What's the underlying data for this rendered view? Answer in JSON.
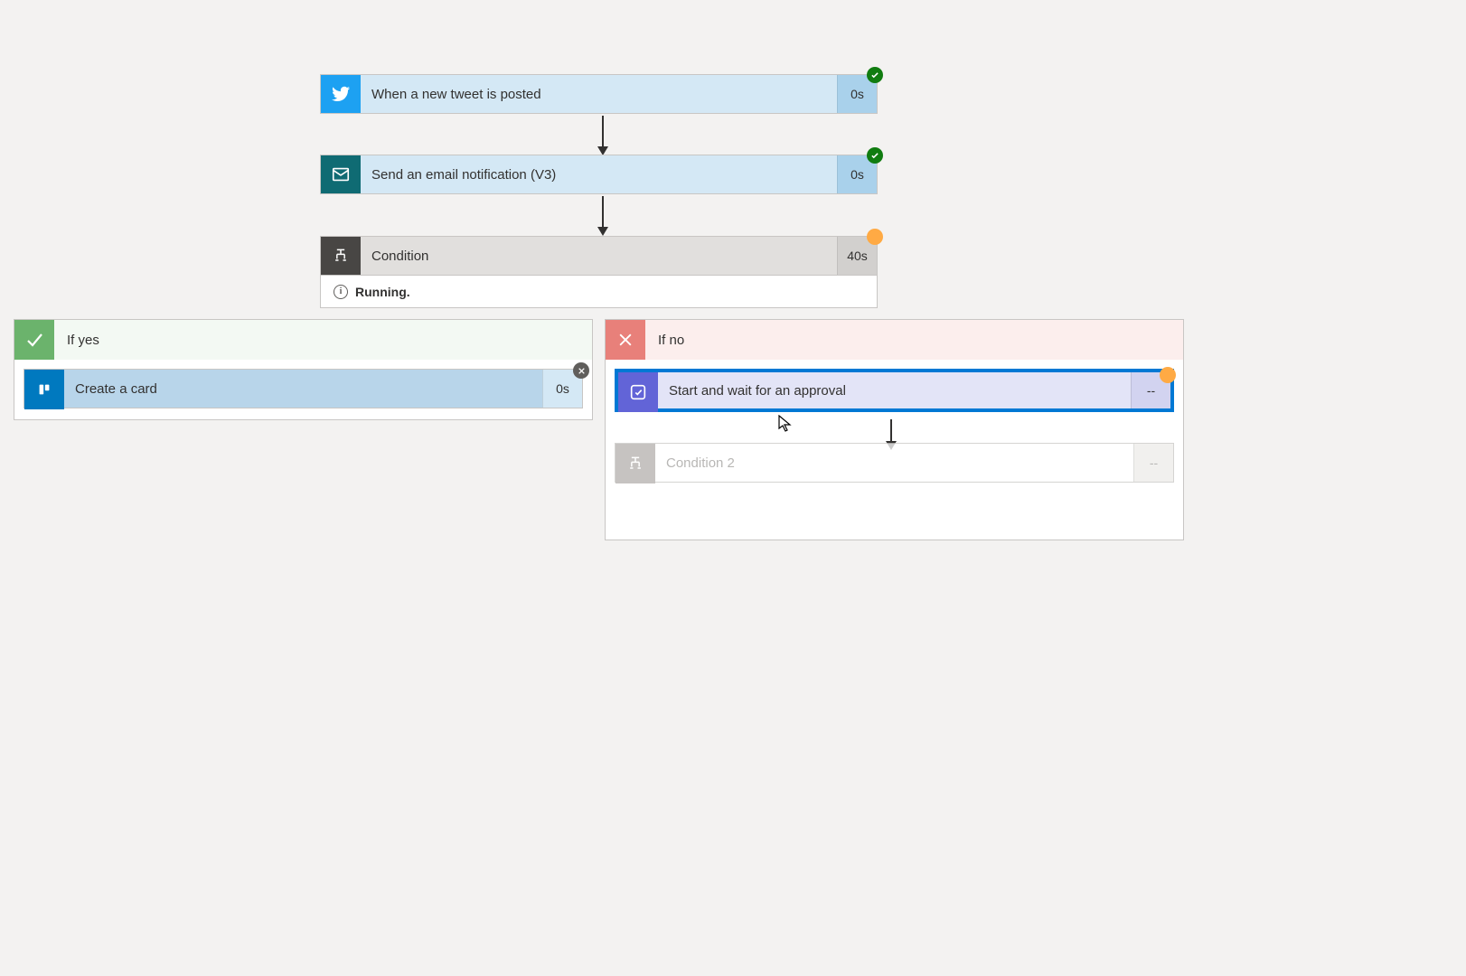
{
  "trigger": {
    "label": "When a new tweet is posted",
    "timing": "0s",
    "icon_bg": "#1da1f2",
    "body_bg": "#d4e8f5",
    "timing_bg": "#a9d1eb",
    "status": "success"
  },
  "action_email": {
    "label": "Send an email notification (V3)",
    "timing": "0s",
    "icon_bg": "#0f6b73",
    "body_bg": "#d4e8f5",
    "timing_bg": "#a9d1eb",
    "status": "success"
  },
  "condition": {
    "label": "Condition",
    "timing": "40s",
    "icon_bg": "#484644",
    "body_bg": "#e1dfdd",
    "timing_bg": "#d2d0ce",
    "status": "running",
    "status_text": "Running."
  },
  "branch_yes": {
    "header_label": "If yes",
    "header_icon_bg": "#6bb36c",
    "header_bg": "#f3f9f3",
    "action": {
      "label": "Create a card",
      "timing": "0s",
      "icon_bg": "#0079bf",
      "body_bg": "#b8d5ea",
      "timing_bg": "#d4e8f5",
      "status": "cancelled"
    }
  },
  "branch_no": {
    "header_label": "If no",
    "header_icon_bg": "#e8807a",
    "header_bg": "#fceeed",
    "action_approval": {
      "label": "Start and wait for an approval",
      "timing": "--",
      "icon_bg": "#6264d7",
      "body_bg": "#e3e4f7",
      "timing_bg": "#d2d3f0",
      "selected": true,
      "status": "running"
    },
    "action_condition2": {
      "label": "Condition 2",
      "timing": "--",
      "icon_bg": "#b3b0ad",
      "body_bg": "#ffffff",
      "timing_bg": "#edebe9",
      "disabled": true
    }
  },
  "colors": {
    "status_green": "#107c10",
    "status_orange": "#ffaa44",
    "selection": "#0078d4"
  }
}
